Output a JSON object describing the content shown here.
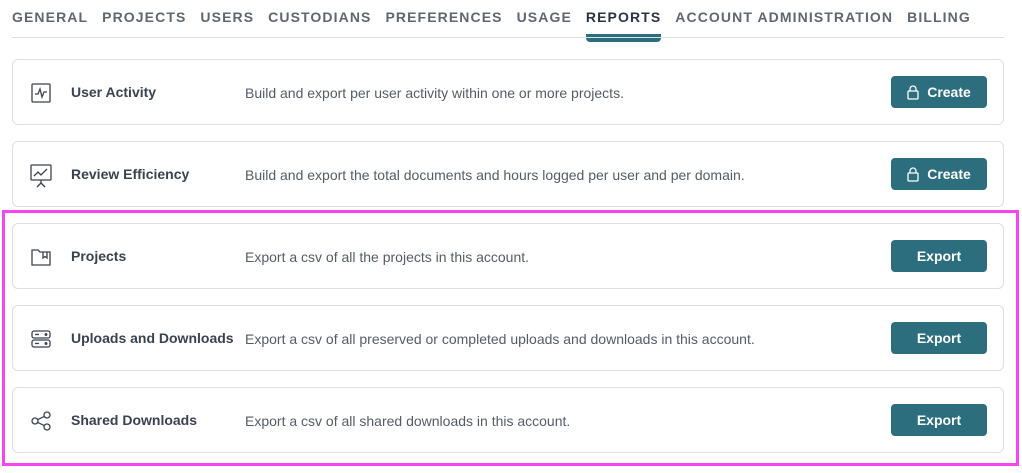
{
  "tabs": [
    {
      "label": "GENERAL"
    },
    {
      "label": "PROJECTS"
    },
    {
      "label": "USERS"
    },
    {
      "label": "CUSTODIANS"
    },
    {
      "label": "PREFERENCES"
    },
    {
      "label": "USAGE"
    },
    {
      "label": "REPORTS",
      "active": true
    },
    {
      "label": "ACCOUNT ADMINISTRATION"
    },
    {
      "label": "BILLING"
    }
  ],
  "reports": [
    {
      "icon": "activity-chart-icon",
      "title": "User Activity",
      "description": "Build and export per user activity within one or more projects.",
      "button": "Create",
      "locked": true
    },
    {
      "icon": "presentation-chart-icon",
      "title": "Review Efficiency",
      "description": "Build and export the total documents and hours logged per user and per domain.",
      "button": "Create",
      "locked": true
    },
    {
      "icon": "folder-icon",
      "title": "Projects",
      "description": "Export a csv of all the projects in this account.",
      "button": "Export",
      "locked": false
    },
    {
      "icon": "server-storage-icon",
      "title": "Uploads and Downloads",
      "description": "Export a csv of all preserved or completed uploads and downloads in this account.",
      "button": "Export",
      "locked": false
    },
    {
      "icon": "share-icon",
      "title": "Shared Downloads",
      "description": "Export a csv of all shared downloads in this account.",
      "button": "Export",
      "locked": false
    }
  ],
  "colors": {
    "accent": "#2c6e7e",
    "highlight": "#f546f0",
    "border": "#dcdfe3",
    "title_text": "#3a4250",
    "body_text": "#555c66"
  }
}
